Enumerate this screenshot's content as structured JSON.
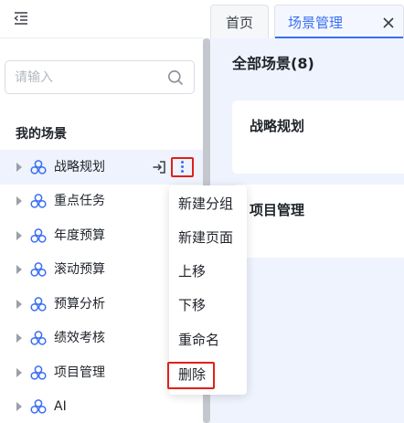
{
  "search": {
    "placeholder": "请输入"
  },
  "sidebar": {
    "section_title": "我的场景",
    "items": [
      {
        "label": "战略规划"
      },
      {
        "label": "重点任务"
      },
      {
        "label": "年度预算"
      },
      {
        "label": "滚动预算"
      },
      {
        "label": "预算分析"
      },
      {
        "label": "绩效考核"
      },
      {
        "label": "项目管理"
      },
      {
        "label": "AI"
      }
    ]
  },
  "context_menu": {
    "items": [
      "新建分组",
      "新建页面",
      "上移",
      "下移",
      "重命名",
      "删除"
    ]
  },
  "tabs": [
    {
      "label": "首页"
    },
    {
      "label": "场景管理"
    }
  ],
  "main": {
    "title": "全部场景(8)",
    "cards": [
      {
        "title": "战略规划"
      },
      {
        "title": "项目管理"
      }
    ]
  },
  "colors": {
    "accent": "#3a6ff2",
    "highlight_border": "#e0201a",
    "content_bg": "#eef3fd"
  }
}
